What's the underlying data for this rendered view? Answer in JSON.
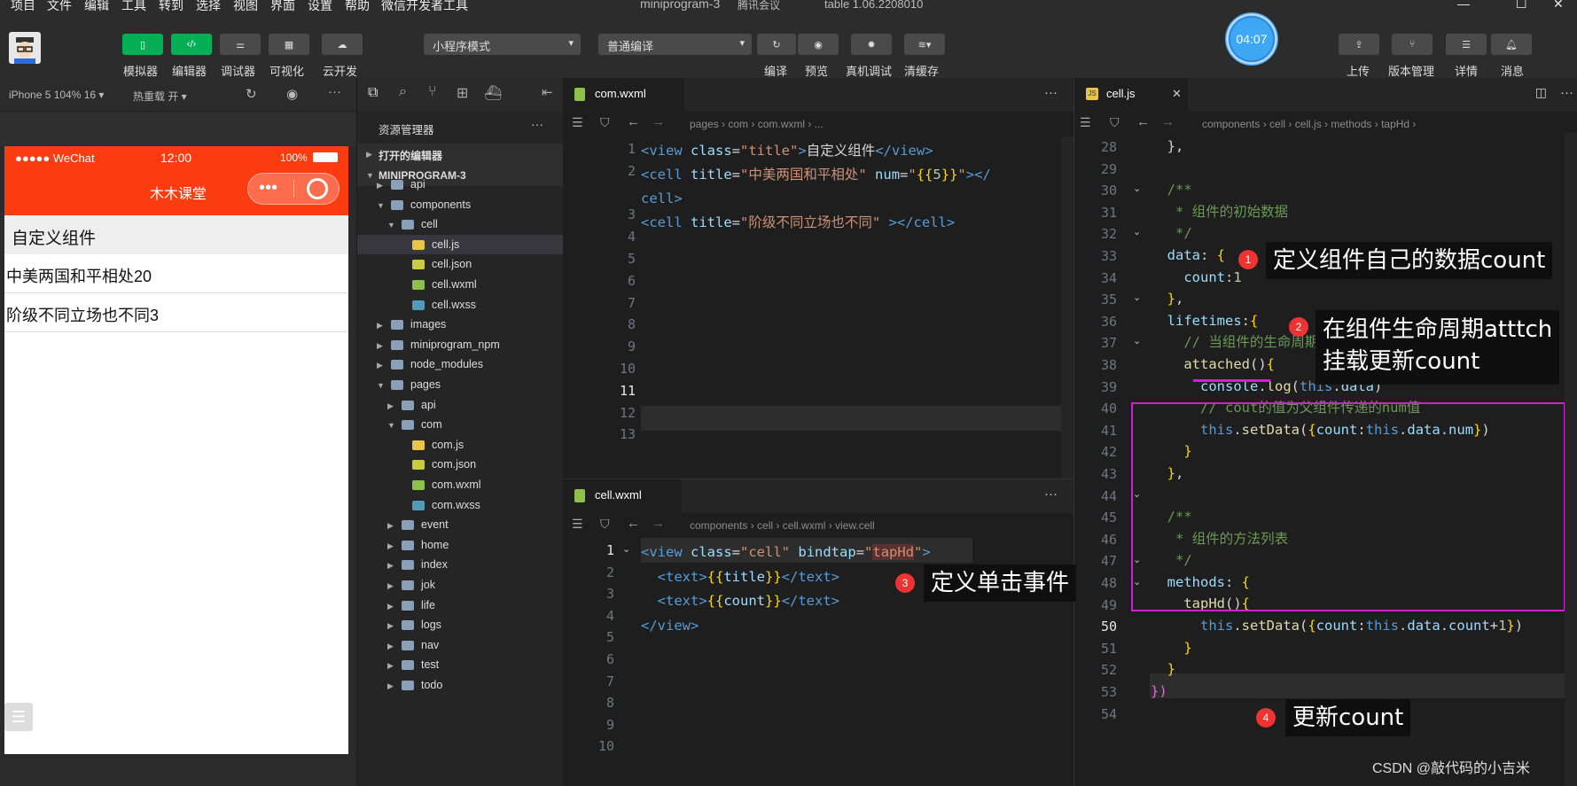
{
  "menu": [
    "项目",
    "文件",
    "编辑",
    "工具",
    "转到",
    "选择",
    "视图",
    "界面",
    "设置",
    "帮助",
    "微信开发者工具"
  ],
  "window_title": "miniprogram-3",
  "meeting_label": "腾讯会议",
  "version": "table 1.06.2208010",
  "toolbar": {
    "simulator": "模拟器",
    "editor": "编辑器",
    "debugger": "调试器",
    "visual": "可视化",
    "cloud": "云开发",
    "mode": "小程序模式",
    "compile_mode": "普通编译",
    "compile": "编译",
    "preview": "预览",
    "real_debug": "真机调试",
    "clear_cache": "清缓存",
    "upload": "上传",
    "version_mgmt": "版本管理",
    "details": "详情",
    "messages": "消息",
    "timer": "04:07"
  },
  "simulator": {
    "device": "iPhone 5 104% 16 ▾",
    "hot_reload": "热重载 开 ▾",
    "status_carrier": "●●●●● WeChat",
    "status_time": "12:00",
    "status_battery": "100%",
    "nav_title": "木木课堂",
    "page_title": "自定义组件",
    "rows": [
      "中美两国和平相处20",
      "阶级不同立场也不同3"
    ]
  },
  "explorer": {
    "title": "资源管理器",
    "open_editors": "打开的编辑器",
    "project": "MINIPROGRAM-3",
    "items": [
      {
        "label": "api",
        "depth": 1,
        "arrow": "▶"
      },
      {
        "label": "components",
        "depth": 1,
        "arrow": "▼"
      },
      {
        "label": "cell",
        "depth": 2,
        "arrow": "▼"
      },
      {
        "label": "cell.js",
        "depth": 3,
        "arrow": ""
      },
      {
        "label": "cell.json",
        "depth": 3,
        "arrow": ""
      },
      {
        "label": "cell.wxml",
        "depth": 3,
        "arrow": ""
      },
      {
        "label": "cell.wxss",
        "depth": 3,
        "arrow": ""
      },
      {
        "label": "images",
        "depth": 1,
        "arrow": "▶"
      },
      {
        "label": "miniprogram_npm",
        "depth": 1,
        "arrow": "▶"
      },
      {
        "label": "node_modules",
        "depth": 1,
        "arrow": "▶"
      },
      {
        "label": "pages",
        "depth": 1,
        "arrow": "▼"
      },
      {
        "label": "api",
        "depth": 2,
        "arrow": "▶"
      },
      {
        "label": "com",
        "depth": 2,
        "arrow": "▼"
      },
      {
        "label": "com.js",
        "depth": 3,
        "arrow": ""
      },
      {
        "label": "com.json",
        "depth": 3,
        "arrow": ""
      },
      {
        "label": "com.wxml",
        "depth": 3,
        "arrow": ""
      },
      {
        "label": "com.wxss",
        "depth": 3,
        "arrow": ""
      },
      {
        "label": "event",
        "depth": 2,
        "arrow": "▶"
      },
      {
        "label": "home",
        "depth": 2,
        "arrow": "▶"
      },
      {
        "label": "index",
        "depth": 2,
        "arrow": "▶"
      },
      {
        "label": "jok",
        "depth": 2,
        "arrow": "▶"
      },
      {
        "label": "life",
        "depth": 2,
        "arrow": "▶"
      },
      {
        "label": "logs",
        "depth": 2,
        "arrow": "▶"
      },
      {
        "label": "nav",
        "depth": 2,
        "arrow": "▶"
      },
      {
        "label": "test",
        "depth": 2,
        "arrow": "▶"
      },
      {
        "label": "todo",
        "depth": 2,
        "arrow": "▶"
      }
    ]
  },
  "editor1": {
    "tab": "com.wxml",
    "breadcrumb": "pages  ›  com  ›     com.wxml  ›  ...",
    "lines": [
      "1",
      "2",
      "",
      "3",
      "4",
      "5",
      "6",
      "7",
      "8",
      "9",
      "10",
      "11",
      "12",
      "13"
    ]
  },
  "editor2": {
    "tab": "cell.wxml",
    "breadcrumb": "components  ›  cell  ›     cell.wxml  ›     view.cell",
    "lines": [
      "1",
      "2",
      "3",
      "4",
      "5",
      "6",
      "7",
      "8",
      "9",
      "10"
    ]
  },
  "editor3": {
    "tab": "cell.js",
    "breadcrumb": "components  ›  cell  ›     cell.js  ›     methods  ›     tapHd  ›",
    "lines": [
      "28",
      "29",
      "30",
      "31",
      "32",
      "33",
      "34",
      "35",
      "36",
      "37",
      "38",
      "39",
      "40",
      "41",
      "42",
      "43",
      "44",
      "45",
      "46",
      "47",
      "48",
      "49",
      "50",
      "51",
      "52",
      "53",
      "54"
    ]
  },
  "annotations": {
    "a1": "定义组件自己的数据count",
    "a2_line1": "在组件生命周期atttch",
    "a2_line2": "挂载更新count",
    "a3": "定义单击事件",
    "a4": "更新count",
    "n1": "1",
    "n2": "2",
    "n3": "3",
    "n4": "4"
  },
  "watermark": "CSDN @敲代码的小吉米"
}
